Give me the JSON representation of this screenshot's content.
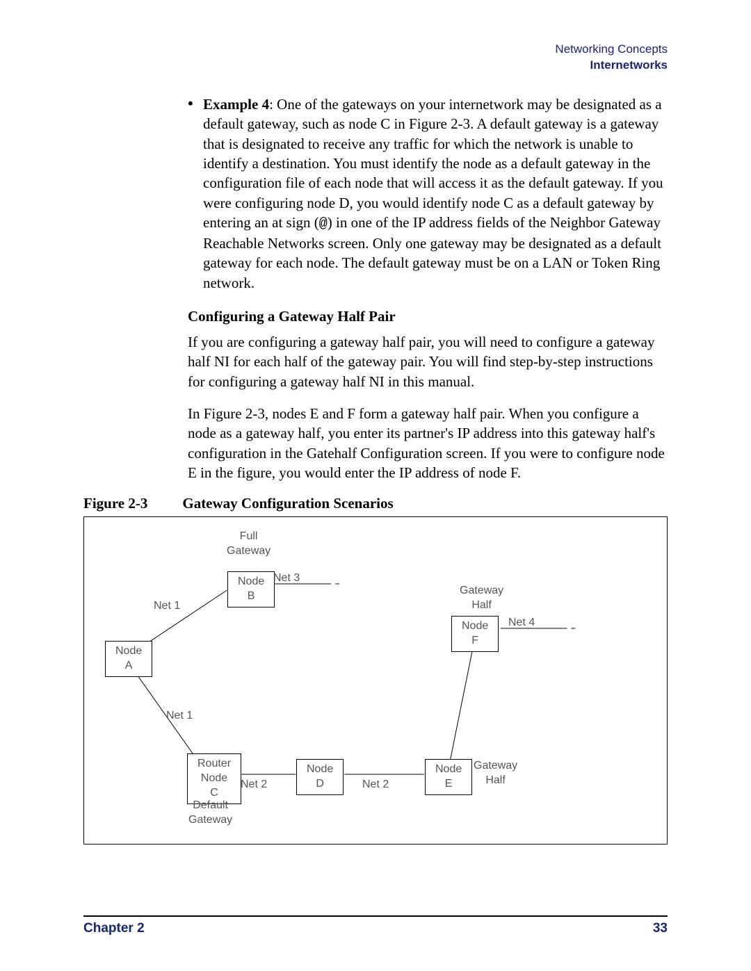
{
  "header": {
    "line1": "Networking Concepts",
    "line2": "Internetworks"
  },
  "bullet": {
    "lead": "Example 4",
    "text": ": One of the gateways on your internetwork may be designated as a default gateway, such as node C in Figure 2-3. A default gateway is a gateway that is designated to receive any traffic for which the network is unable to identify a destination. You must identify the node as a default gateway in the configuration file of each node that will access it as the default gateway. If you were configuring node D, you would identify node C as a default gateway by entering an at sign (",
    "code": "@",
    "text2": ") in one of the IP address fields of the Neighbor Gateway Reachable Networks screen. Only one gateway may be designated as a default gateway for each node. The default gateway must be on a LAN or Token Ring network."
  },
  "subheading": "Configuring a Gateway Half Pair",
  "p1": "If you are configuring a gateway half pair, you will need to configure a gateway half NI for each half of the gateway pair. You will find step-by-step instructions for configuring a gateway half NI in this manual.",
  "p2": "In Figure 2-3, nodes E and F form a gateway half pair. When you configure a node as a gateway half, you enter its partner's IP address into this gateway half's configuration in the Gatehalf Configuration screen. If you were to configure node E in the figure, you would enter the IP address of node F.",
  "fig": {
    "num": "Figure 2-3",
    "title": "Gateway Configuration Scenarios"
  },
  "diagram": {
    "full_gateway": "Full\nGateway",
    "node_a": "Node\nA",
    "node_b": "Node\nB",
    "node_c": "Router\nNode\nC",
    "default_gw": "Default\nGateway",
    "node_d": "Node\nD",
    "node_e": "Node\nE",
    "node_f": "Node\nF",
    "gateway_half_top": "Gateway\nHalf",
    "gateway_half_right": "Gateway\nHalf",
    "net1a": "Net 1",
    "net1b": "Net 1",
    "net2a": "Net 2",
    "net2b": "Net 2",
    "net3": "Net 3",
    "net4": "Net 4"
  },
  "footer": {
    "left": "Chapter 2",
    "right": "33"
  }
}
